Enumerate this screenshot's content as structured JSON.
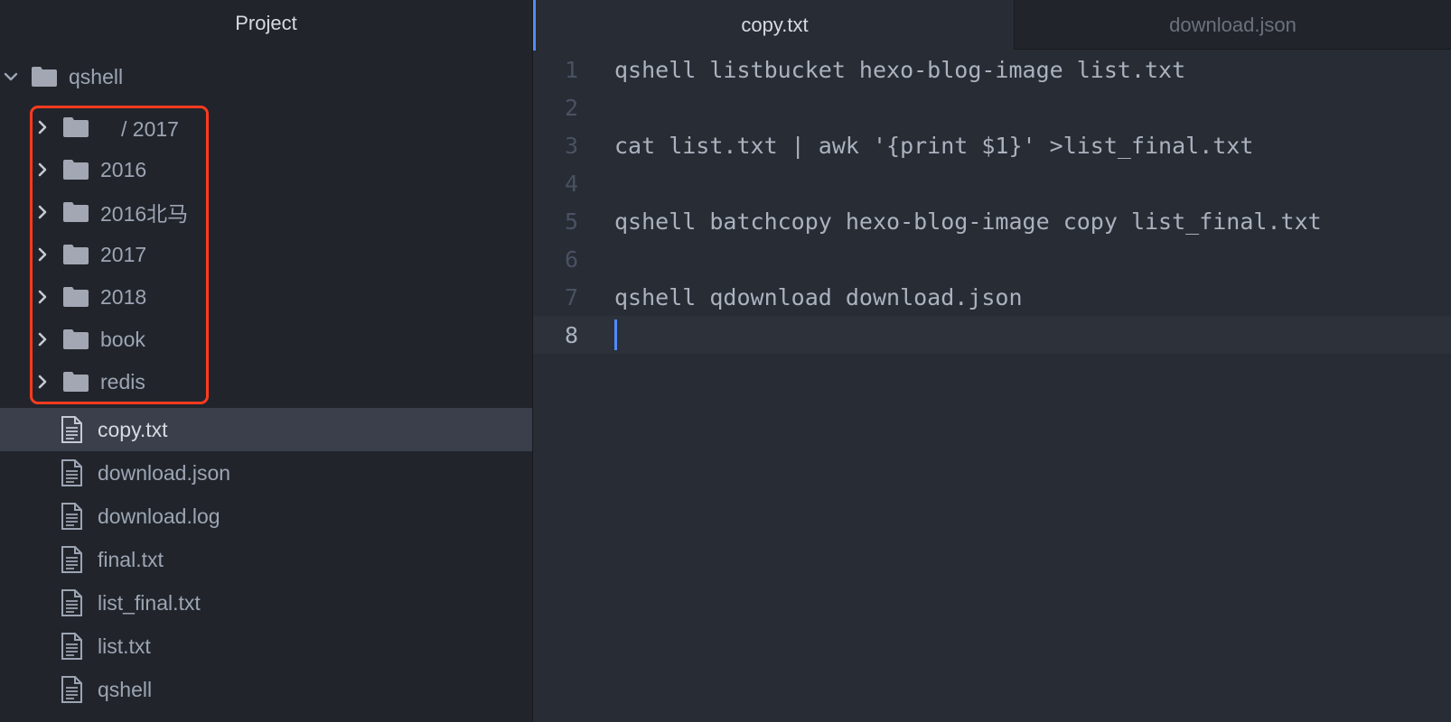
{
  "sidebar": {
    "title": "Project",
    "root": {
      "label": "qshell",
      "expanded": true
    },
    "folders": [
      {
        "label": "　/ 2017"
      },
      {
        "label": "2016"
      },
      {
        "label": "2016北马"
      },
      {
        "label": "2017"
      },
      {
        "label": "2018"
      },
      {
        "label": "book"
      },
      {
        "label": "redis"
      }
    ],
    "files": [
      {
        "label": "copy.txt",
        "selected": true
      },
      {
        "label": "download.json"
      },
      {
        "label": "download.log"
      },
      {
        "label": "final.txt"
      },
      {
        "label": "list_final.txt"
      },
      {
        "label": "list.txt"
      },
      {
        "label": "qshell"
      }
    ],
    "highlight_color": "#ff3b1f"
  },
  "editor": {
    "tabs": [
      {
        "label": "copy.txt",
        "active": true
      },
      {
        "label": "download.json",
        "active": false
      }
    ],
    "lines": [
      {
        "num": "1",
        "text": "qshell listbucket hexo-blog-image list.txt"
      },
      {
        "num": "2",
        "text": ""
      },
      {
        "num": "3",
        "text": "cat list.txt | awk '{print $1}' >list_final.txt"
      },
      {
        "num": "4",
        "text": ""
      },
      {
        "num": "5",
        "text": "qshell batchcopy hexo-blog-image copy list_final.txt"
      },
      {
        "num": "6",
        "text": ""
      },
      {
        "num": "7",
        "text": "qshell qdownload download.json"
      },
      {
        "num": "8",
        "text": ""
      }
    ],
    "cursor_line": 8,
    "accent": "#528bff"
  },
  "icons": {
    "folder": "folder-icon",
    "file": "file-text-icon",
    "expand": "chevron-right-icon",
    "collapse": "chevron-down-icon"
  }
}
